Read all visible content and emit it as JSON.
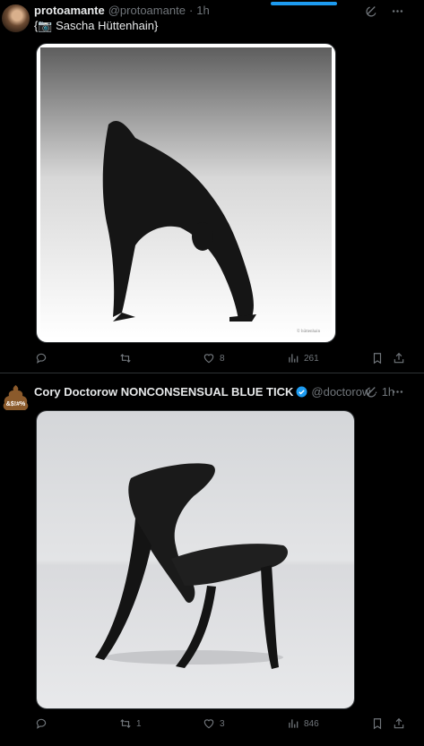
{
  "tweets": [
    {
      "display_name": "protoamante",
      "handle": "@protoamante",
      "time": "1h",
      "text": "{📷 Sascha Hüttenhain}",
      "media_credit": "© hüttenhain",
      "actions": {
        "reply": "",
        "retweet": "",
        "like": "8",
        "views": "261"
      }
    },
    {
      "display_name": "Cory Doctorow NONCONSENSUAL BLUE TICK",
      "handle": "@doctorow",
      "time": "1h",
      "avatar_text": "&$!#%",
      "actions": {
        "reply": "",
        "retweet": "1",
        "like": "3",
        "views": "846"
      }
    }
  ]
}
